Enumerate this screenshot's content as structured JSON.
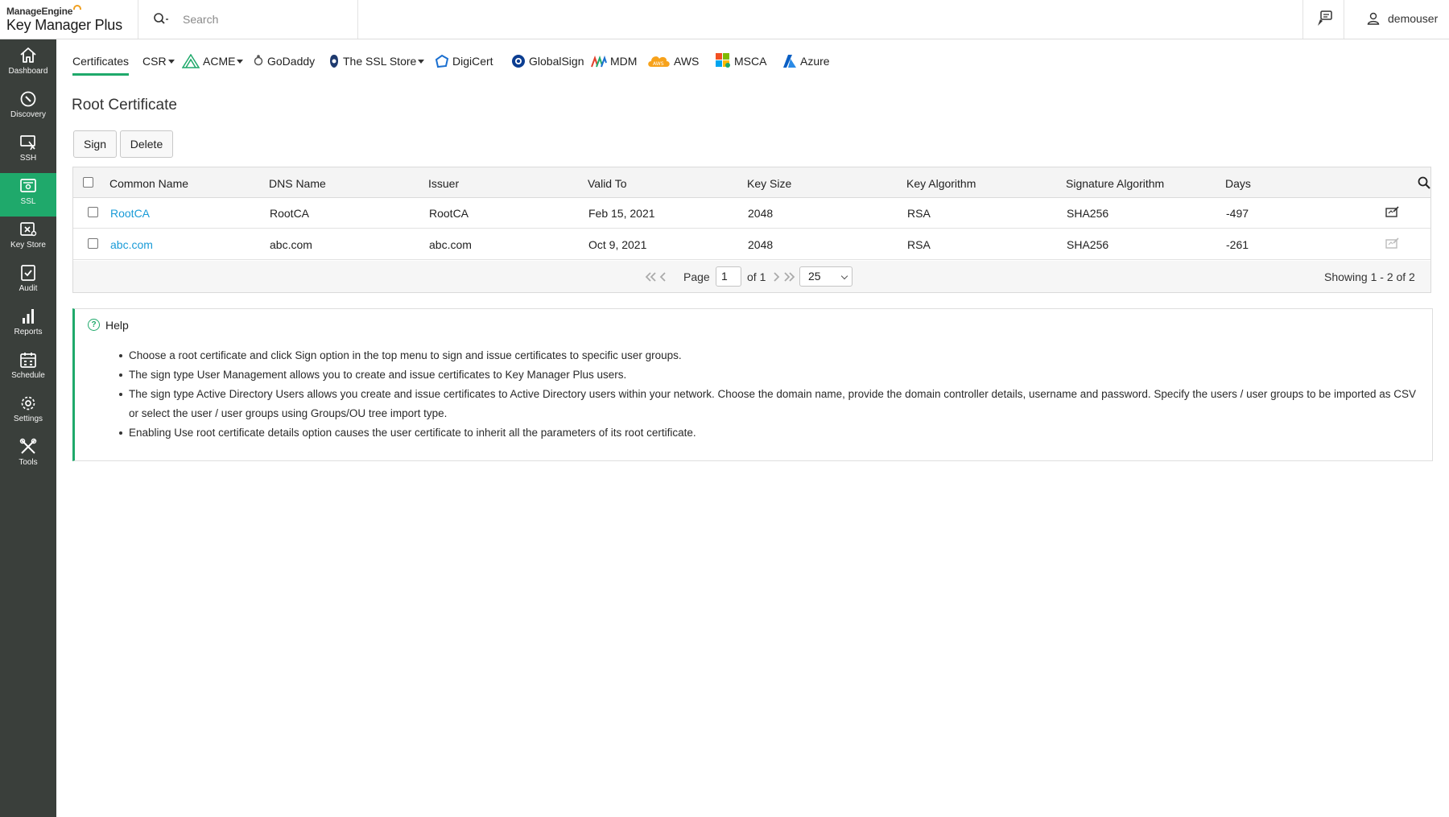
{
  "brand": {
    "company": "ManageEngine",
    "product": "Key Manager Plus"
  },
  "search": {
    "placeholder": "Search"
  },
  "user": {
    "name": "demouser"
  },
  "sidebar": {
    "items": [
      {
        "label": "Dashboard",
        "icon": "home-icon"
      },
      {
        "label": "Discovery",
        "icon": "compass-icon"
      },
      {
        "label": "SSH",
        "icon": "ssh-icon"
      },
      {
        "label": "SSL",
        "icon": "ssl-certificate-icon",
        "active": true
      },
      {
        "label": "Key Store",
        "icon": "key-store-icon"
      },
      {
        "label": "Audit",
        "icon": "audit-check-icon"
      },
      {
        "label": "Reports",
        "icon": "bar-chart-icon"
      },
      {
        "label": "Schedule",
        "icon": "calendar-icon"
      },
      {
        "label": "Settings",
        "icon": "gear-icon"
      },
      {
        "label": "Tools",
        "icon": "tools-icon"
      }
    ]
  },
  "tabs": {
    "certificates": "Certificates",
    "csr": "CSR",
    "acme": "ACME",
    "godaddy": "GoDaddy",
    "sslstore": "The SSL Store",
    "digicert": "DigiCert",
    "globalsign": "GlobalSign",
    "mdm": "MDM",
    "aws": "AWS",
    "msca": "MSCA",
    "azure": "Azure"
  },
  "page": {
    "title": "Root Certificate"
  },
  "toolbar": {
    "sign_label": "Sign",
    "delete_label": "Delete"
  },
  "table": {
    "columns": [
      "Common Name",
      "DNS Name",
      "Issuer",
      "Valid To",
      "Key Size",
      "Key Algorithm",
      "Signature Algorithm",
      "Days"
    ],
    "rows": [
      {
        "common_name": "RootCA",
        "dns_name": "RootCA",
        "issuer": "RootCA",
        "valid_to": "Feb 15, 2021",
        "key_size": "2048",
        "key_algorithm": "RSA",
        "signature_algorithm": "SHA256",
        "days": "-497"
      },
      {
        "common_name": "abc.com",
        "dns_name": "abc.com",
        "issuer": "abc.com",
        "valid_to": "Oct 9, 2021",
        "key_size": "2048",
        "key_algorithm": "RSA",
        "signature_algorithm": "SHA256",
        "days": "-261"
      }
    ]
  },
  "pagination": {
    "page_label": "Page",
    "page_value": "1",
    "of_label": "of 1",
    "per_page": "25",
    "showing": "Showing 1 - 2 of 2"
  },
  "help": {
    "title": "Help",
    "items": [
      "Choose a root certificate and click Sign option in the top menu to sign and issue certificates to specific user groups.",
      "The sign type User Management allows you to create and issue certificates to Key Manager Plus users.",
      "The sign type Active Directory Users allows you create and issue certificates to Active Directory users within your network. Choose the domain name, provide the domain controller details, username and password. Specify the users / user groups to be imported as CSV or select the user / user groups using Groups/OU tree import type.",
      "Enabling Use root certificate details option causes the user certificate to inherit all the parameters of its root certificate."
    ]
  },
  "colors": {
    "accent": "#1fa96b",
    "sidebar": "#3a3f3b",
    "link": "#1a9bd7"
  }
}
